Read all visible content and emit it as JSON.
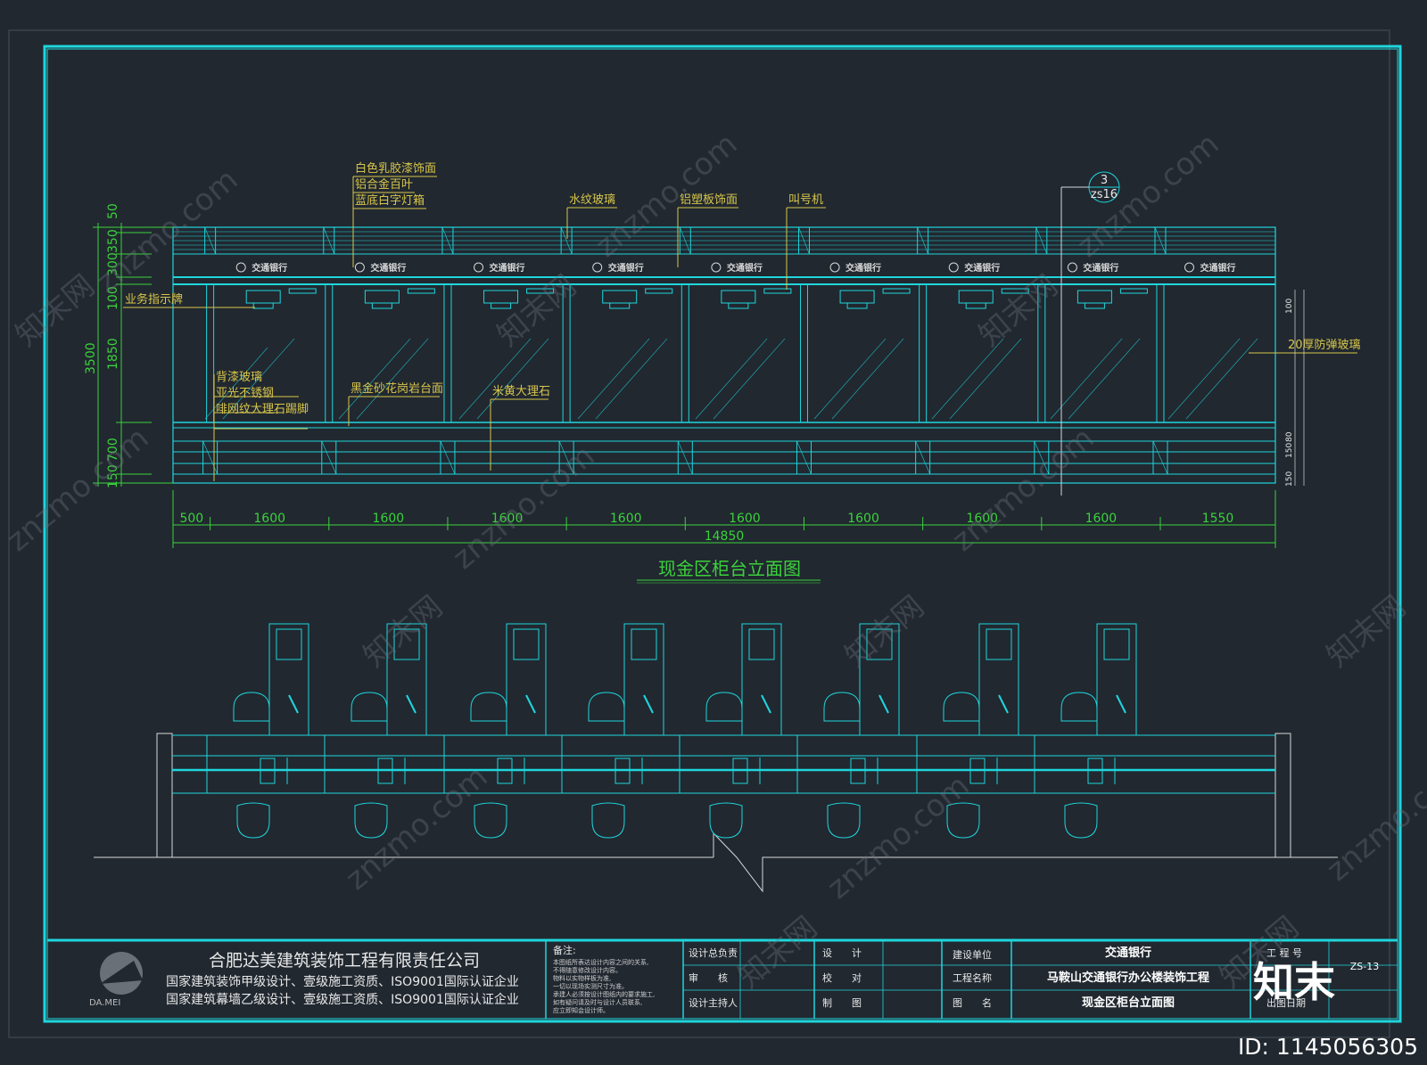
{
  "drawing": {
    "title": "现金区柜台立面图",
    "section_ref": {
      "number": "3",
      "sheet": "zs16"
    }
  },
  "callouts": {
    "top_left": [
      "白色乳胶漆饰面",
      "铝合金百叶",
      "蓝底白字灯箱"
    ],
    "water_glass": "水纹玻璃",
    "alu_panel": "铝塑板饰面",
    "queue_machine": "叫号机",
    "sign_board": "业务指示牌",
    "bulletproof": "20厚防弹玻璃",
    "left_materials": [
      "背漆玻璃",
      "亚光不锈钢",
      "啡网纹大理石踢脚"
    ],
    "countertop": "黑金砂花岗岩台面",
    "marble": "米黄大理石"
  },
  "bank_logo": "交通银行",
  "dimensions": {
    "horizontal": [
      "500",
      "1600",
      "1600",
      "1600",
      "1600",
      "1600",
      "1600",
      "1600",
      "1600",
      "1550"
    ],
    "total": "14850",
    "vertical": [
      "50",
      "350",
      "300",
      "100",
      "1850",
      "700",
      "150"
    ],
    "vertical_total": "3500",
    "right_small": [
      "100",
      "80",
      "150",
      "150",
      "80",
      "150"
    ]
  },
  "title_block": {
    "company": "合肥达美建筑装饰工程有限责任公司",
    "quals": [
      "国家建筑装饰甲级设计、壹级施工资质、ISO9001国际认证企业",
      "国家建筑幕墙乙级设计、壹级施工资质、ISO9001国际认证企业"
    ],
    "logo_text": "DA.MEI",
    "notes_title": "备注:",
    "notes": [
      "本图纸所表达设计内容之间的关系,",
      "不得随意修改设计内容。",
      "物料以实物样板为准,",
      "一切以现场实测尺寸为准。",
      "承建人必须按设计图纸内的要求施工,",
      "如有疑问请及时与设计人员联系,",
      "应立即知会设计师。"
    ],
    "labels": {
      "chief": "设计总负责",
      "review": "审　　核",
      "host": "设计主持人",
      "design": "设　　计",
      "check": "校　　对",
      "draw": "制　　图",
      "client": "建设单位",
      "project": "工程名称",
      "drawing_name": "图　　名",
      "project_no": "工 程 号",
      "date": "出图日期"
    },
    "client_value": "交通银行",
    "project_value": "马鞍山交通银行办公楼装饰工程",
    "drawing_value": "现金区柜台立面图",
    "sheet_no": "ZS-13"
  },
  "watermark": {
    "site": "znzmo.com",
    "brand": "知末网",
    "logo": "知末",
    "id": "ID: 1145056305"
  }
}
